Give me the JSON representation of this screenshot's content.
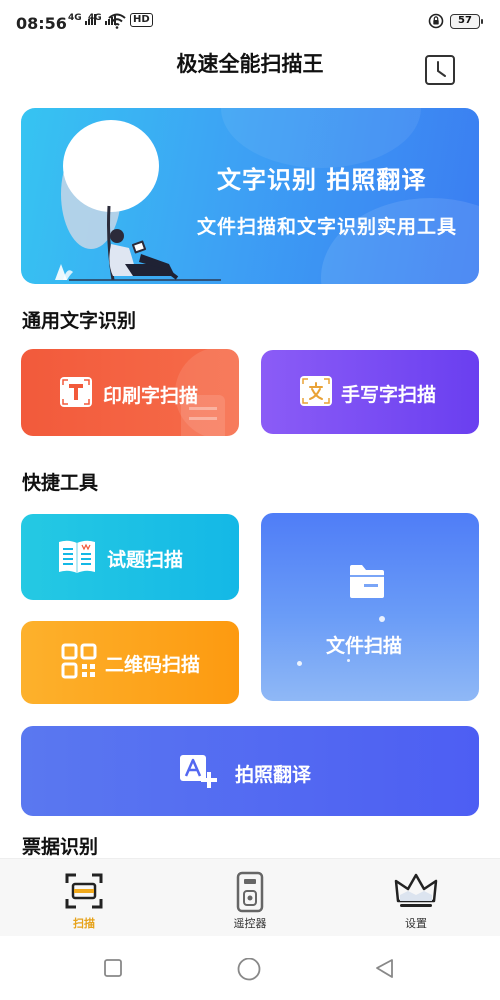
{
  "status_bar": {
    "time": "08:56",
    "signal1": "4G",
    "signal2": "4G",
    "hd": "HD",
    "battery": "57"
  },
  "header": {
    "title": "极速全能扫描王",
    "history_icon": "clock-icon"
  },
  "banner": {
    "title": "文字识别 拍照翻译",
    "subtitle": "文件扫描和文字识别实用工具"
  },
  "sections": {
    "ocr_title": "通用文字识别",
    "tools_title": "快捷工具",
    "receipt_title": "票据识别"
  },
  "cards": {
    "print_scan": "印刷字扫描",
    "handwrite_scan": "手写字扫描",
    "exam_scan": "试题扫描",
    "qr_scan": "二维码扫描",
    "file_scan": "文件扫描",
    "photo_translate": "拍照翻译"
  },
  "tabbar": {
    "items": [
      {
        "label": "扫描",
        "icon": "scan-icon",
        "active": true
      },
      {
        "label": "遥控器",
        "icon": "remote-icon",
        "active": false
      },
      {
        "label": "设置",
        "icon": "crown-icon",
        "active": false
      }
    ]
  },
  "colors": {
    "accent": "#e6a21a",
    "banner": "#3da2f4",
    "print": "#f25a3b",
    "handwrite": "#7a4df3",
    "exam": "#1fc0e5",
    "qr": "#fda61e",
    "file": "#5a8af7",
    "translate": "#5468f1"
  }
}
